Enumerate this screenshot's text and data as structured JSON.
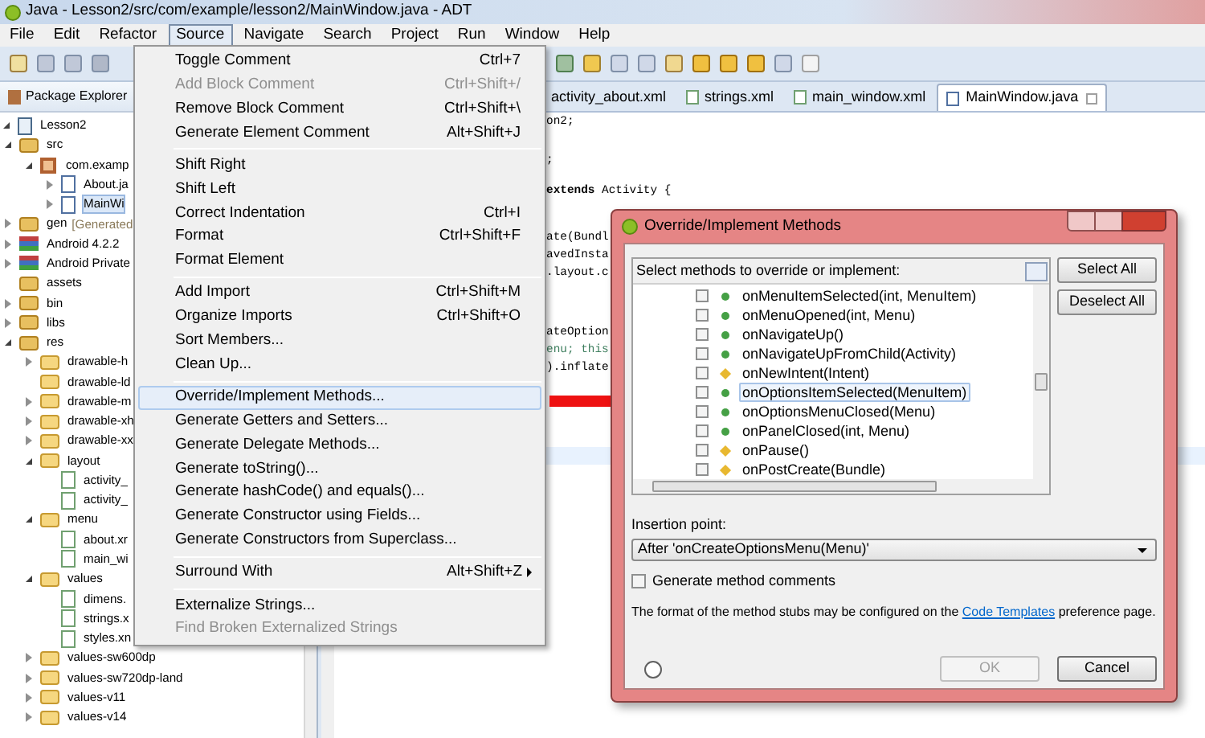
{
  "window": {
    "title": "Java - Lesson2/src/com/example/lesson2/MainWindow.java - ADT"
  },
  "menubar": [
    {
      "label": "File",
      "selected": false
    },
    {
      "label": "Edit",
      "selected": false
    },
    {
      "label": "Refactor",
      "selected": false
    },
    {
      "label": "Source",
      "selected": true
    },
    {
      "label": "Navigate",
      "selected": false
    },
    {
      "label": "Search",
      "selected": false
    },
    {
      "label": "Project",
      "selected": false
    },
    {
      "label": "Run",
      "selected": false
    },
    {
      "label": "Window",
      "selected": false
    },
    {
      "label": "Help",
      "selected": false
    }
  ],
  "package_explorer": {
    "title": "Package Explorer",
    "tree": [
      {
        "label": "Lesson2",
        "kind": "project",
        "expanded": true,
        "selected": false,
        "children": [
          {
            "label": "src",
            "kind": "src-folder",
            "expanded": true,
            "selected": false,
            "children": [
              {
                "label": "com.examp",
                "kind": "package",
                "expanded": true,
                "selected": false,
                "children": [
                  {
                    "label": "About.ja",
                    "kind": "java",
                    "expanded": false,
                    "selected": false
                  },
                  {
                    "label": "MainWi",
                    "kind": "java",
                    "expanded": false,
                    "selected": true
                  }
                ]
              }
            ]
          },
          {
            "label": "gen",
            "decoration": "[Generated",
            "kind": "res-folder",
            "expanded": false,
            "selected": false
          },
          {
            "label": "Android 4.2.2",
            "kind": "library",
            "expanded": false,
            "selected": false
          },
          {
            "label": "Android Private",
            "kind": "library",
            "expanded": false,
            "selected": false
          },
          {
            "label": "assets",
            "kind": "res-folder",
            "selected": false
          },
          {
            "label": "bin",
            "kind": "res-folder",
            "expanded": false,
            "selected": false
          },
          {
            "label": "libs",
            "kind": "res-folder",
            "expanded": false,
            "selected": false
          },
          {
            "label": "res",
            "kind": "res-folder",
            "expanded": true,
            "selected": false,
            "children": [
              {
                "label": "drawable-h",
                "kind": "folder",
                "expanded": false,
                "selected": false
              },
              {
                "label": "drawable-ld",
                "kind": "folder",
                "selected": false
              },
              {
                "label": "drawable-m",
                "kind": "folder",
                "expanded": false,
                "selected": false
              },
              {
                "label": "drawable-xh",
                "kind": "folder",
                "expanded": false,
                "selected": false
              },
              {
                "label": "drawable-xx",
                "kind": "folder",
                "expanded": false,
                "selected": false
              },
              {
                "label": "layout",
                "kind": "folder",
                "expanded": true,
                "selected": false,
                "children": [
                  {
                    "label": "activity_",
                    "kind": "xml",
                    "selected": false
                  },
                  {
                    "label": "activity_",
                    "kind": "xml",
                    "selected": false
                  }
                ]
              },
              {
                "label": "menu",
                "kind": "folder",
                "expanded": true,
                "selected": false,
                "children": [
                  {
                    "label": "about.xr",
                    "kind": "xml",
                    "selected": false
                  },
                  {
                    "label": "main_wi",
                    "kind": "xml",
                    "selected": false
                  }
                ]
              },
              {
                "label": "values",
                "kind": "folder",
                "expanded": true,
                "selected": false,
                "children": [
                  {
                    "label": "dimens.",
                    "kind": "xml",
                    "selected": false
                  },
                  {
                    "label": "strings.x",
                    "kind": "xml",
                    "selected": false
                  },
                  {
                    "label": "styles.xn",
                    "kind": "xml",
                    "selected": false
                  }
                ]
              },
              {
                "label": "values-sw600dp",
                "kind": "folder",
                "expanded": false,
                "selected": false
              },
              {
                "label": "values-sw720dp-land",
                "kind": "folder",
                "expanded": false,
                "selected": false
              },
              {
                "label": "values-v11",
                "kind": "folder",
                "expanded": false,
                "selected": false
              },
              {
                "label": "values-v14",
                "kind": "folder",
                "expanded": false,
                "selected": false
              }
            ]
          }
        ]
      }
    ]
  },
  "editor": {
    "tabs": [
      {
        "label": "activity_about.xml",
        "selected": false
      },
      {
        "label": "strings.xml",
        "kind": "xml",
        "selected": false
      },
      {
        "label": "main_window.xml",
        "kind": "xml",
        "selected": false
      },
      {
        "label": "MainWindow.java",
        "kind": "java",
        "selected": true
      }
    ],
    "lines": [
      {
        "text": "on2;",
        "kind": "code"
      },
      {
        "text": ";",
        "kind": "code"
      },
      {
        "text": "**extends** Activity {",
        "kind": "code"
      },
      {
        "text": "ate(Bundl",
        "kind": "code"
      },
      {
        "text": "avedInsta",
        "kind": "code"
      },
      {
        "text": ".layout.c",
        "kind": "code"
      },
      {
        "text": "ateOption",
        "kind": "code"
      },
      {
        "text": "enu; this",
        "kind": "comment"
      },
      {
        "text": ").inflate",
        "kind": "code"
      }
    ]
  },
  "source_menu": {
    "items": [
      {
        "kind": "item",
        "label": "Toggle Comment",
        "shortcut": "Ctrl+7",
        "disabled": false,
        "selected": false
      },
      {
        "kind": "item",
        "label": "Add Block Comment",
        "shortcut": "Ctrl+Shift+/",
        "disabled": true,
        "selected": false
      },
      {
        "kind": "item",
        "label": "Remove Block Comment",
        "shortcut": "Ctrl+Shift+\\",
        "disabled": false,
        "selected": false
      },
      {
        "kind": "item",
        "label": "Generate Element Comment",
        "shortcut": "Alt+Shift+J",
        "disabled": false,
        "selected": false
      },
      {
        "kind": "separator"
      },
      {
        "kind": "item",
        "label": "Shift Right",
        "disabled": false,
        "selected": false
      },
      {
        "kind": "item",
        "label": "Shift Left",
        "disabled": false,
        "selected": false
      },
      {
        "kind": "item",
        "label": "Correct Indentation",
        "shortcut": "Ctrl+I",
        "disabled": false,
        "selected": false
      },
      {
        "kind": "item",
        "label": "Format",
        "shortcut": "Ctrl+Shift+F",
        "disabled": false,
        "selected": false
      },
      {
        "kind": "item",
        "label": "Format Element",
        "disabled": false,
        "selected": false
      },
      {
        "kind": "separator"
      },
      {
        "kind": "item",
        "label": "Add Import",
        "shortcut": "Ctrl+Shift+M",
        "disabled": false,
        "selected": false
      },
      {
        "kind": "item",
        "label": "Organize Imports",
        "shortcut": "Ctrl+Shift+O",
        "disabled": false,
        "selected": false
      },
      {
        "kind": "item",
        "label": "Sort Members...",
        "disabled": false,
        "selected": false
      },
      {
        "kind": "item",
        "label": "Clean Up...",
        "disabled": false,
        "selected": false
      },
      {
        "kind": "separator"
      },
      {
        "kind": "item",
        "label": "Override/Implement Methods...",
        "disabled": false,
        "selected": true
      },
      {
        "kind": "item",
        "label": "Generate Getters and Setters...",
        "disabled": false,
        "selected": false
      },
      {
        "kind": "item",
        "label": "Generate Delegate Methods...",
        "disabled": false,
        "selected": false
      },
      {
        "kind": "item",
        "label": "Generate toString()...",
        "disabled": false,
        "selected": false
      },
      {
        "kind": "item",
        "label": "Generate hashCode() and equals()...",
        "disabled": false,
        "selected": false
      },
      {
        "kind": "item",
        "label": "Generate Constructor using Fields...",
        "disabled": false,
        "selected": false
      },
      {
        "kind": "item",
        "label": "Generate Constructors from Superclass...",
        "disabled": false,
        "selected": false
      },
      {
        "kind": "separator"
      },
      {
        "kind": "submenu",
        "label": "Surround With",
        "shortcut": "Alt+Shift+Z",
        "disabled": false,
        "selected": false
      },
      {
        "kind": "separator"
      },
      {
        "kind": "item",
        "label": "Externalize Strings...",
        "disabled": false,
        "selected": false
      },
      {
        "kind": "item",
        "label": "Find Broken Externalized Strings",
        "disabled": true,
        "selected": false
      }
    ]
  },
  "dialog": {
    "title": "Override/Implement Methods",
    "list_heading": "Select methods to override or implement:",
    "methods": [
      {
        "label": "onMenuItemSelected(int, MenuItem)",
        "kind": "public",
        "checked": false,
        "selected": false
      },
      {
        "label": "onMenuOpened(int, Menu)",
        "kind": "public",
        "checked": false,
        "selected": false
      },
      {
        "label": "onNavigateUp()",
        "kind": "public",
        "checked": false,
        "selected": false
      },
      {
        "label": "onNavigateUpFromChild(Activity)",
        "kind": "public",
        "checked": false,
        "selected": false
      },
      {
        "label": "onNewIntent(Intent)",
        "kind": "protected",
        "checked": false,
        "selected": false
      },
      {
        "label": "onOptionsItemSelected(MenuItem)",
        "kind": "public",
        "checked": false,
        "selected": true
      },
      {
        "label": "onOptionsMenuClosed(Menu)",
        "kind": "public",
        "checked": false,
        "selected": false
      },
      {
        "label": "onPanelClosed(int, Menu)",
        "kind": "public",
        "checked": false,
        "selected": false
      },
      {
        "label": "onPause()",
        "kind": "protected",
        "checked": false,
        "selected": false
      },
      {
        "label": "onPostCreate(Bundle)",
        "kind": "protected",
        "checked": false,
        "selected": false
      }
    ],
    "side_buttons": [
      "Select All",
      "Deselect All"
    ],
    "insertion_label": "Insertion point:",
    "insertion_value": "After 'onCreateOptionsMenu(Menu)'",
    "comments_option": {
      "label": "Generate method comments",
      "checked": false
    },
    "note": {
      "before": "The format of the method stubs may be configured on the",
      "link": "Code Templates",
      "after": "preference page."
    },
    "buttons": [
      {
        "label": "OK",
        "disabled": true
      },
      {
        "label": "Cancel",
        "disabled": false
      }
    ]
  }
}
